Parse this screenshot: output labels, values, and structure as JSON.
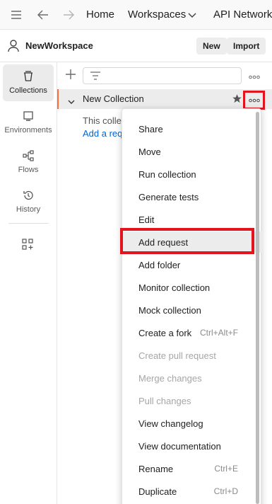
{
  "topbar": {
    "icons": [
      "menu-icon",
      "back-arrow-icon",
      "forward-arrow-icon",
      "chevron-down-icon"
    ],
    "home": "Home",
    "workspaces": "Workspaces",
    "api_network": "API Network"
  },
  "workspace": {
    "name": "NewWorkspace",
    "new_label": "New",
    "import_label": "Import"
  },
  "rail": {
    "items": [
      {
        "label": "Collections",
        "icon": "collections-icon",
        "active": true
      },
      {
        "label": "Environments",
        "icon": "environments-icon",
        "active": false
      },
      {
        "label": "Flows",
        "icon": "flows-icon",
        "active": false
      },
      {
        "label": "History",
        "icon": "history-icon",
        "active": false
      }
    ],
    "extra_icon": "add-apps-icon"
  },
  "sidebar": {
    "collection_name": "New Collection",
    "empty_text": "This colle",
    "empty_link": "Add a req"
  },
  "menu": {
    "items": [
      {
        "label": "Share",
        "shortcut": "",
        "disabled": false
      },
      {
        "label": "Move",
        "shortcut": "",
        "disabled": false
      },
      {
        "label": "Run collection",
        "shortcut": "",
        "disabled": false
      },
      {
        "label": "Generate tests",
        "shortcut": "",
        "disabled": false
      },
      {
        "label": "Edit",
        "shortcut": "",
        "disabled": false
      },
      {
        "label": "Add request",
        "shortcut": "",
        "disabled": false
      },
      {
        "label": "Add folder",
        "shortcut": "",
        "disabled": false
      },
      {
        "label": "Monitor collection",
        "shortcut": "",
        "disabled": false
      },
      {
        "label": "Mock collection",
        "shortcut": "",
        "disabled": false
      },
      {
        "label": "Create a fork",
        "shortcut": "Ctrl+Alt+F",
        "disabled": false
      },
      {
        "label": "Create pull request",
        "shortcut": "",
        "disabled": true
      },
      {
        "label": "Merge changes",
        "shortcut": "",
        "disabled": true
      },
      {
        "label": "Pull changes",
        "shortcut": "",
        "disabled": true
      },
      {
        "label": "View changelog",
        "shortcut": "",
        "disabled": false
      },
      {
        "label": "View documentation",
        "shortcut": "",
        "disabled": false
      },
      {
        "label": "Rename",
        "shortcut": "Ctrl+E",
        "disabled": false
      },
      {
        "label": "Duplicate",
        "shortcut": "Ctrl+D",
        "disabled": false
      }
    ]
  },
  "colors": {
    "accent": "#ff6c37",
    "highlight_red": "#e3141d",
    "link": "#0265d2"
  }
}
